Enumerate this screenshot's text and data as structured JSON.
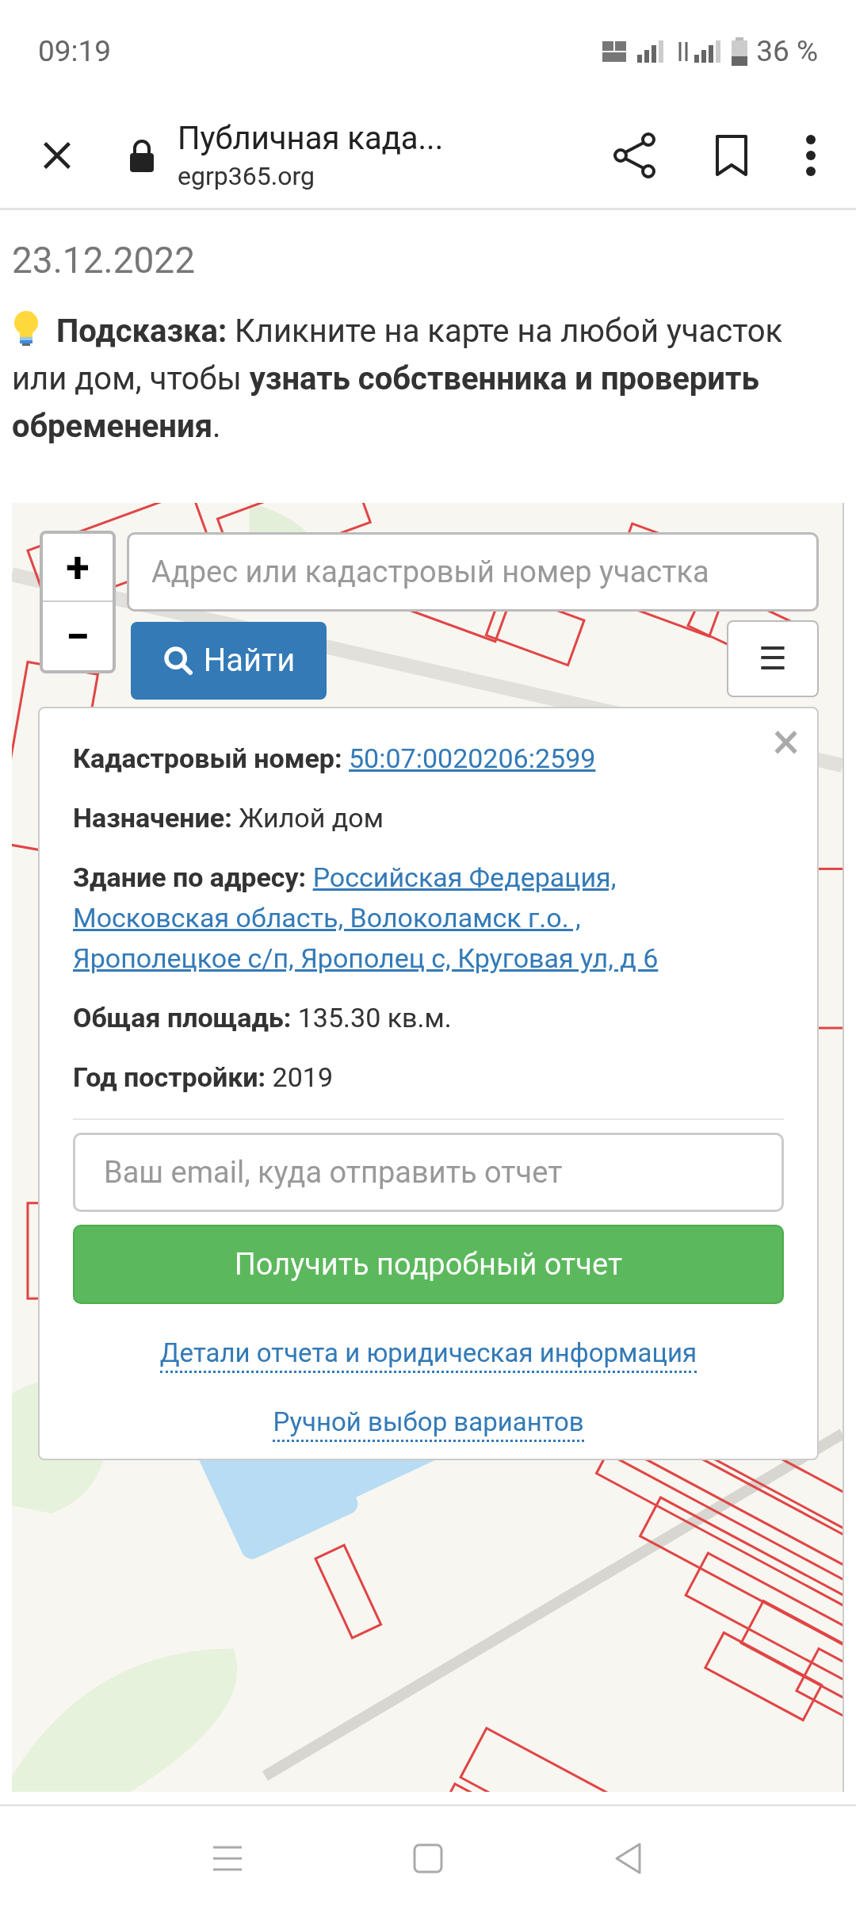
{
  "status_bar": {
    "time": "09:19",
    "battery": "36 %"
  },
  "browser": {
    "title": "Публичная када...",
    "url": "egrp365.org"
  },
  "page": {
    "date": "23.12.2022",
    "hint": "**Подсказка:** Кликните на карте на любой участок или дом, чтобы **узнать собственника и проверить обременения**."
  },
  "map": {
    "zoom_in": "+",
    "zoom_out": "−",
    "search": {
      "placeholder": "Адрес или кадастровый номер участка"
    },
    "find_button": "Найти",
    "menu_button": "☰",
    "popup": {
      "close": "×",
      "fields": [
        {
          "label": "Кадастровый номер:",
          "value": "50:07:0020206:2599",
          "kind": "link"
        },
        {
          "label": "Назначение:",
          "value": "Жилой дом",
          "kind": "text"
        },
        {
          "label": "Здание по адресу:",
          "value": [
            "Российская Федерация,",
            "Московская область, Волоколамск г.о. ,",
            "Ярополецкое с/п, Ярополец с, Круговая ул, д 6"
          ],
          "kind": "link"
        },
        {
          "label": "Общая площадь:",
          "value": "135.30 кв.м.",
          "kind": "text"
        },
        {
          "label": "Год постройки:",
          "value": "2019",
          "kind": "text"
        }
      ],
      "email": {
        "placeholder": "Ваш email, куда отправить отчет"
      },
      "report_button": "Получить подробный отчет",
      "links": [
        "Детали отчета и юридическая информация",
        "Ручной выбор вариантов"
      ]
    }
  }
}
